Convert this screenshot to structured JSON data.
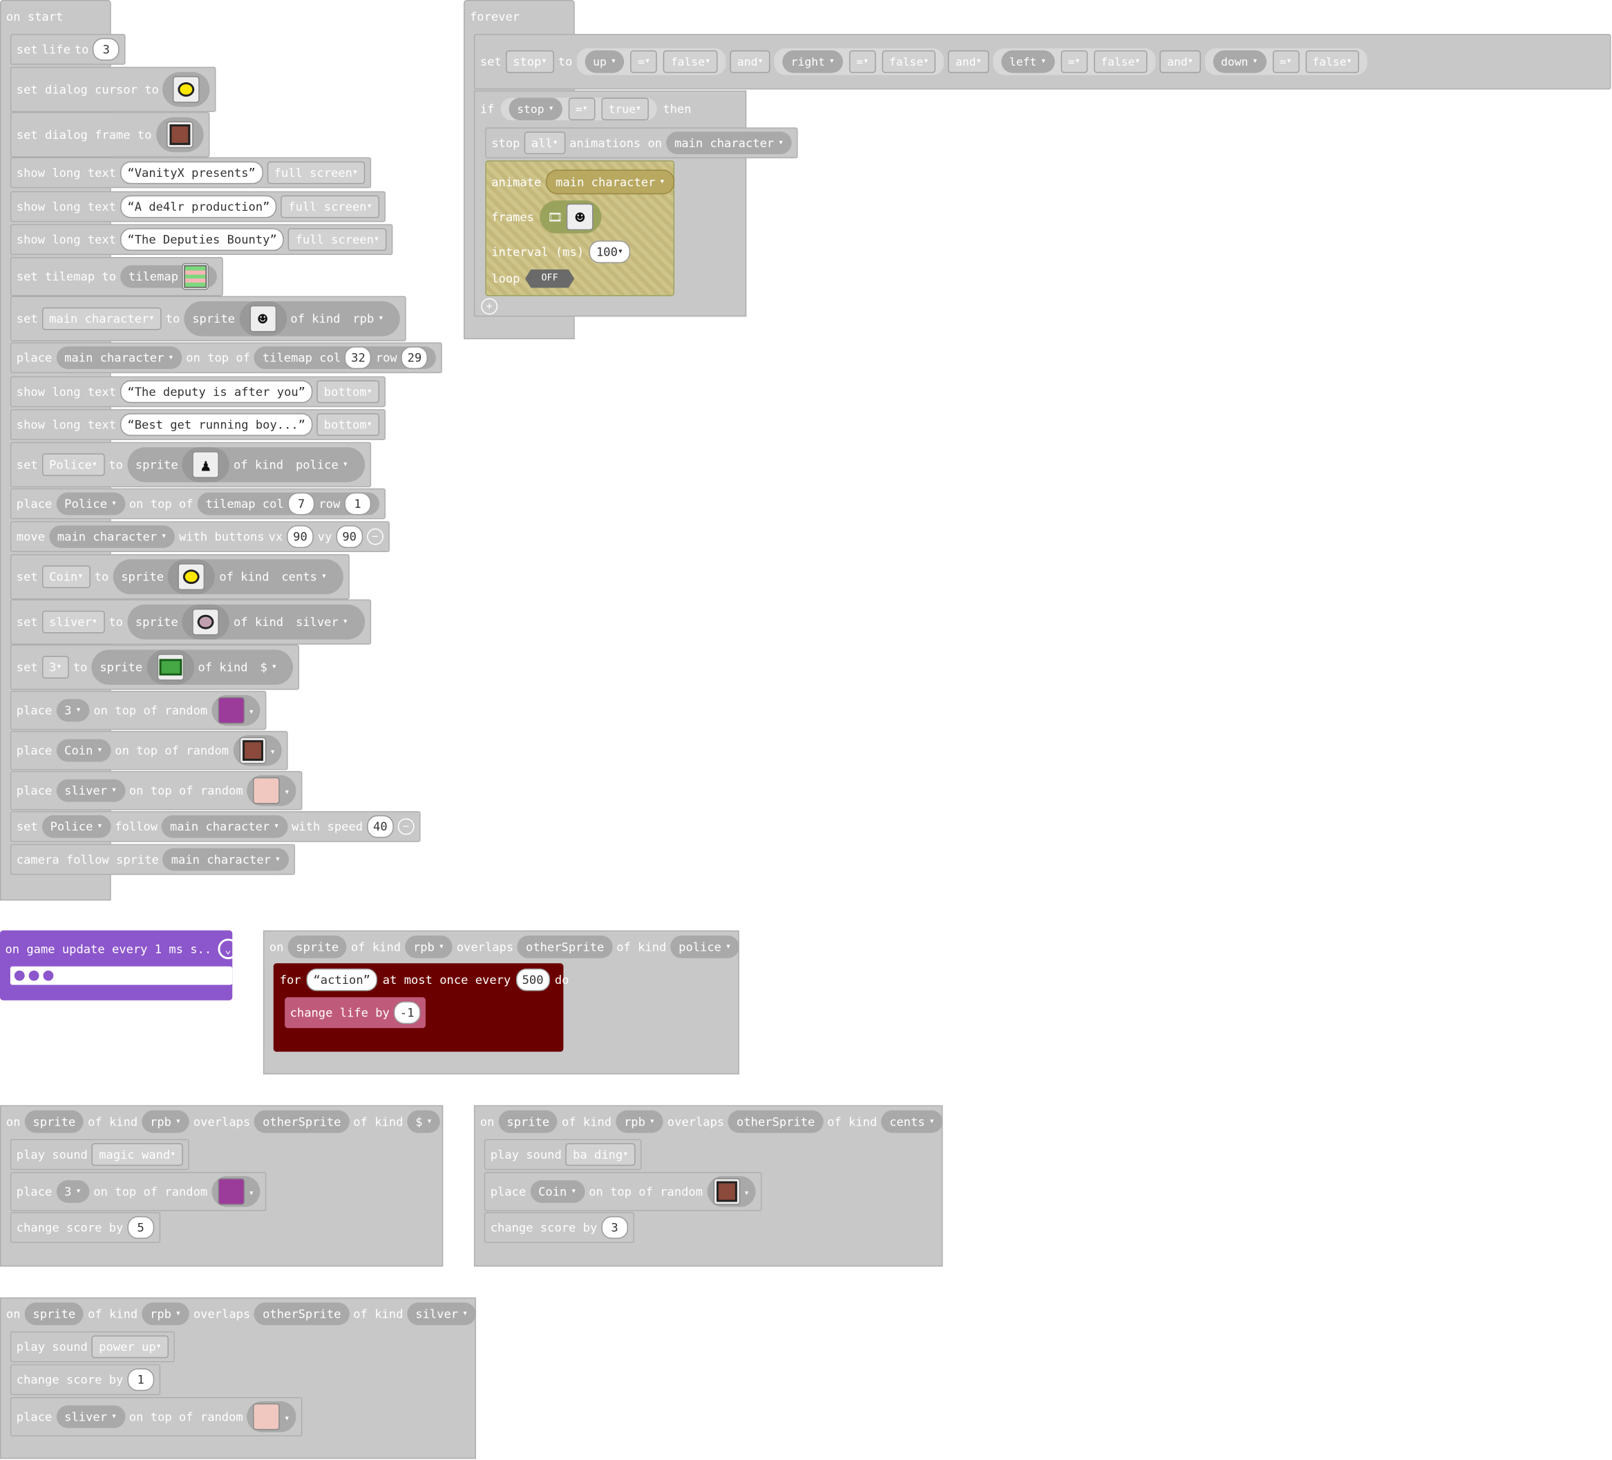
{
  "on_start": {
    "hat": "on start",
    "set_life": {
      "set": "set",
      "var": "life",
      "to": "to",
      "value": "3"
    },
    "dialog_cursor": {
      "label": "set dialog cursor to"
    },
    "dialog_frame": {
      "label": "set dialog frame to"
    },
    "long_texts": [
      {
        "label": "show long text",
        "text": "VanityX presents",
        "pos": "full screen"
      },
      {
        "label": "show long text",
        "text": "A de4lr production",
        "pos": "full screen"
      },
      {
        "label": "show long text",
        "text": "The Deputies Bounty",
        "pos": "full screen"
      }
    ],
    "tilemap": {
      "label": "set tilemap to",
      "value": "tilemap"
    },
    "set_main": {
      "set": "set",
      "var": "main character",
      "to": "to",
      "sprite": "sprite",
      "of_kind": "of kind",
      "kind": "rpb"
    },
    "place_main": {
      "place": "place",
      "var": "main character",
      "on_top": "on top of",
      "tilemap": "tilemap col",
      "col": "32",
      "row_label": "row",
      "row": "29"
    },
    "long_texts_2": [
      {
        "label": "show long text",
        "text": "The deputy is after you",
        "pos": "bottom"
      },
      {
        "label": "show long text",
        "text": "Best get running boy...",
        "pos": "bottom"
      }
    ],
    "set_police": {
      "set": "set",
      "var": "Police",
      "to": "to",
      "sprite": "sprite",
      "of_kind": "of kind",
      "kind": "police"
    },
    "place_police": {
      "place": "place",
      "var": "Police",
      "on_top": "on top of",
      "tilemap": "tilemap col",
      "col": "7",
      "row_label": "row",
      "row": "1"
    },
    "move": {
      "move": "move",
      "var": "main character",
      "with": "with buttons",
      "vx_label": "vx",
      "vx": "90",
      "vy_label": "vy",
      "vy": "90"
    },
    "set_coin": {
      "set": "set",
      "var": "Coin",
      "to": "to",
      "sprite": "sprite",
      "of_kind": "of kind",
      "kind": "cents"
    },
    "set_sliver": {
      "set": "set",
      "var": "sliver",
      "to": "to",
      "sprite": "sprite",
      "of_kind": "of kind",
      "kind": "silver"
    },
    "set_3": {
      "set": "set",
      "var": "3",
      "to": "to",
      "sprite": "sprite",
      "of_kind": "of kind",
      "kind": "$"
    },
    "place_3": {
      "place": "place",
      "var": "3",
      "on_top": "on top of random"
    },
    "place_coin": {
      "place": "place",
      "var": "Coin",
      "on_top": "on top of random"
    },
    "place_sliver": {
      "place": "place",
      "var": "sliver",
      "on_top": "on top of random"
    },
    "follow": {
      "set": "set",
      "var": "Police",
      "follow": "follow",
      "target": "main character",
      "with": "with speed",
      "speed": "40"
    },
    "camera": {
      "label": "camera follow sprite",
      "var": "main character"
    }
  },
  "forever": {
    "hat": "forever",
    "set_stop": {
      "set": "set",
      "var": "stop",
      "to": "to",
      "conds": [
        {
          "key": "up",
          "op": "=",
          "val": "false"
        },
        {
          "key": "right",
          "op": "=",
          "val": "false"
        },
        {
          "key": "left",
          "op": "=",
          "val": "false"
        },
        {
          "key": "down",
          "op": "=",
          "val": "false"
        }
      ],
      "and": "and"
    },
    "if": {
      "if": "if",
      "var": "stop",
      "op": "=",
      "val": "true",
      "then": "then"
    },
    "stop_anim": {
      "stop": "stop",
      "which": "all",
      "label": "animations on",
      "target": "main character"
    },
    "animate": {
      "label": "animate",
      "target": "main character",
      "frames": "frames",
      "interval": "interval (ms)",
      "interval_val": "100",
      "loop": "loop",
      "loop_val": "OFF"
    }
  },
  "game_update": {
    "label": "on game update every 1 ms s.."
  },
  "overlap_police": {
    "on": "on",
    "sprite": "sprite",
    "of_kind": "of kind",
    "kind": "rpb",
    "overlaps": "overlaps",
    "other": "otherSprite",
    "of_kind2": "of kind",
    "kind2": "police",
    "for": "for",
    "action": "action",
    "at_most": "at most once every",
    "ms": "500",
    "do": "do",
    "change": "change life by",
    "change_val": "-1"
  },
  "overlap_dollar": {
    "on": "on",
    "sprite": "sprite",
    "of_kind": "of kind",
    "kind": "rpb",
    "overlaps": "overlaps",
    "other": "otherSprite",
    "of_kind2": "of kind",
    "kind2": "$",
    "play": "play sound",
    "sound": "magic wand",
    "place": "place",
    "var": "3",
    "on_top": "on top of random",
    "change": "change score by",
    "change_val": "5"
  },
  "overlap_cents": {
    "on": "on",
    "sprite": "sprite",
    "of_kind": "of kind",
    "kind": "rpb",
    "overlaps": "overlaps",
    "other": "otherSprite",
    "of_kind2": "of kind",
    "kind2": "cents",
    "play": "play sound",
    "sound": "ba ding",
    "place": "place",
    "var": "Coin",
    "on_top": "on top of random",
    "change": "change score by",
    "change_val": "3"
  },
  "overlap_silver": {
    "on": "on",
    "sprite": "sprite",
    "of_kind": "of kind",
    "kind": "rpb",
    "overlaps": "overlaps",
    "other": "otherSprite",
    "of_kind2": "of kind",
    "kind2": "silver",
    "play": "play sound",
    "sound": "power up",
    "change": "change score by",
    "change_val": "1",
    "place": "place",
    "var": "sliver",
    "on_top": "on top of random"
  },
  "icons": {
    "tile": "stick-figure-icon",
    "coin": "coin-icon",
    "frame": "frame-icon",
    "map": "tilemap-icon",
    "police": "police-icon",
    "cash": "cash-icon",
    "sand": "sand-tile-icon",
    "purple": "purple-tile-icon"
  },
  "colors": {
    "block": "#c8c8c8",
    "game_update": "#8c56cc",
    "maroon": "#6b0000",
    "rose": "#c05a7a"
  }
}
